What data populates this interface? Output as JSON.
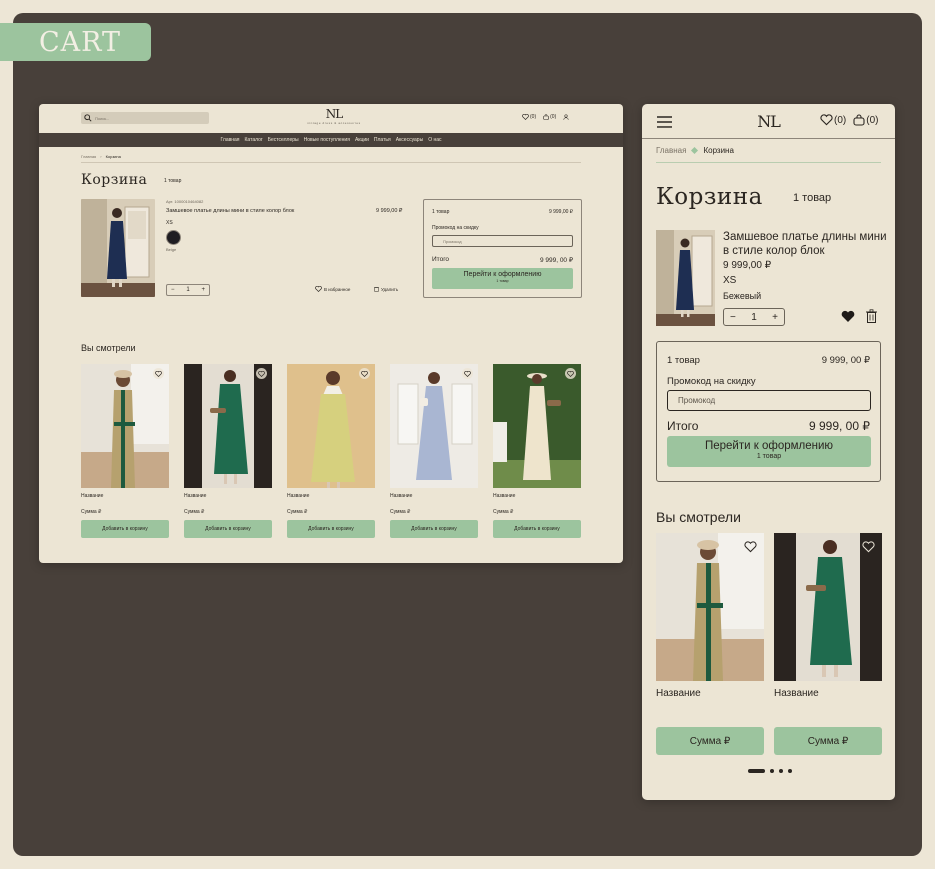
{
  "badge": {
    "label": "CART"
  },
  "desktop": {
    "search_placeholder": "Поиск...",
    "logo_mark": "NL",
    "logo_sub": "vintage dress & accessories",
    "favorites_count": "(0)",
    "cart_count": "(0)",
    "nav": [
      "Главная",
      "Каталог",
      "Бестселлеры",
      "Новые поступления",
      "Акции",
      "Платья",
      "Аксессуары",
      "О нас"
    ],
    "breadcrumb": {
      "home": "Главная",
      "sep": "›",
      "current": "Корзина"
    },
    "title": "Корзина",
    "item_count": "1 товар",
    "product": {
      "article": "Арт. 1000010464082",
      "name": "Замшевое платье длины мини в стиле колор блок",
      "price": "9 999,00 ₽",
      "size": "XS",
      "color": "Beige",
      "qty": "1",
      "minus": "−",
      "plus": "+",
      "favorite": "В избранное",
      "delete": "Удалить"
    },
    "summary": {
      "count": "1 товар",
      "price": "9 999,00 ₽",
      "promo_label": "Промокод на скидку",
      "promo_placeholder": "Промокод",
      "total_label": "Итого",
      "total": "9 999, 00 ₽",
      "checkout": "Перейти к оформлению",
      "checkout_sub": "1 товар"
    },
    "viewed_title": "Вы смотрели",
    "cards": [
      {
        "name": "Название",
        "sum": "Сумма ₽",
        "button": "Добавить в корзину"
      },
      {
        "name": "Название",
        "sum": "Сумма ₽",
        "button": "Добавить в корзину"
      },
      {
        "name": "Название",
        "sum": "Сумма ₽",
        "button": "Добавить в корзину"
      },
      {
        "name": "Название",
        "sum": "Сумма ₽",
        "button": "Добавить в корзину"
      },
      {
        "name": "Название",
        "sum": "Сумма ₽",
        "button": "Добавить в корзину"
      }
    ]
  },
  "mobile": {
    "logo_mark": "NL",
    "favorites_count": "(0)",
    "cart_count": "(0)",
    "breadcrumb": {
      "home": "Главная",
      "current": "Корзина"
    },
    "title": "Корзина",
    "item_count": "1 товар",
    "product": {
      "name": "Замшевое платье длины мини в стиле колор блок",
      "price": "9 999,00 ₽",
      "size": "XS",
      "color": "Бежевый",
      "qty": "1",
      "minus": "−",
      "plus": "+"
    },
    "summary": {
      "count": "1 товар",
      "price": "9 999, 00 ₽",
      "promo_label": "Промокод на скидку",
      "promo_placeholder": "Промокод",
      "total_label": "Итого",
      "total": "9 999, 00 ₽",
      "checkout": "Перейти к оформлению",
      "checkout_sub": "1 товар"
    },
    "viewed_title": "Вы смотрели",
    "cards": [
      {
        "name": "Название",
        "button": "Сумма ₽"
      },
      {
        "name": "Название",
        "button": "Сумма ₽"
      }
    ]
  },
  "colors": {
    "board": "#48403a",
    "page": "#ece5d4",
    "accent": "#9cc49e",
    "text": "#2b2621"
  },
  "icons": [
    "search-icon",
    "heart-icon",
    "bag-icon",
    "user-icon",
    "trash-icon",
    "burger-icon"
  ]
}
